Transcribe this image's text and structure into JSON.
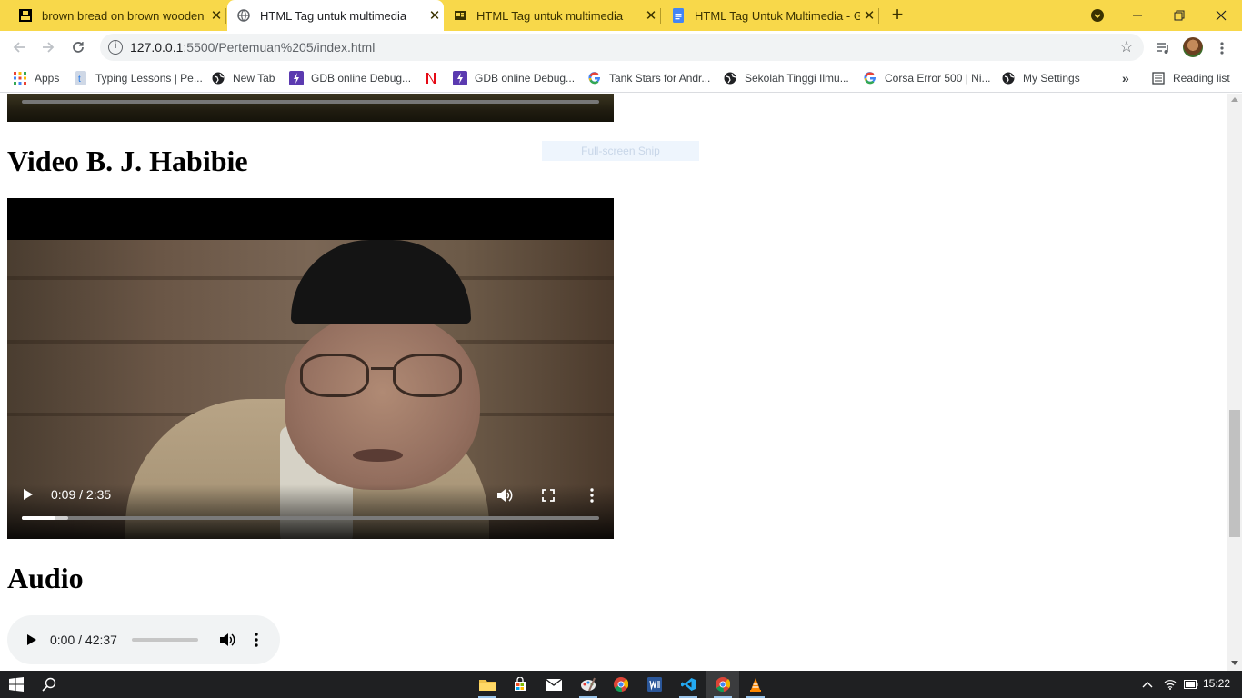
{
  "browser": {
    "tabs": [
      {
        "title": "brown bread on brown wooden t",
        "favicon": "unsplash-icon"
      },
      {
        "title": "HTML Tag untuk multimedia",
        "favicon": "globe-icon",
        "active": true
      },
      {
        "title": "HTML Tag untuk multimedia",
        "favicon": "document-icon"
      },
      {
        "title": "HTML Tag Untuk Multimedia - G",
        "favicon": "docs-icon"
      }
    ],
    "url_host": "127.0.0.1",
    "url_path": ":5500/Pertemuan%205/index.html",
    "bookmarks": [
      {
        "label": "Apps",
        "icon": "apps-grid-icon"
      },
      {
        "label": "Typing Lessons | Pe...",
        "icon": "typing-icon"
      },
      {
        "label": "New Tab",
        "icon": "globe-icon"
      },
      {
        "label": "GDB online Debug...",
        "icon": "gdb-icon"
      },
      {
        "label": "",
        "icon": "netflix-icon"
      },
      {
        "label": "GDB online Debug...",
        "icon": "gdb-icon"
      },
      {
        "label": "Tank Stars for Andr...",
        "icon": "google-icon"
      },
      {
        "label": "Sekolah Tinggi Ilmu...",
        "icon": "globe-icon"
      },
      {
        "label": "Corsa Error 500 | Ni...",
        "icon": "google-icon"
      },
      {
        "label": "My Settings",
        "icon": "globe-icon"
      }
    ],
    "reading_list": "Reading list",
    "colors": {
      "tabstrip": "#f8d84a"
    }
  },
  "page": {
    "video_heading": "Video B. J. Habibie",
    "snip_overlay": "Full-screen Snip",
    "video": {
      "time": "0:09 / 2:35",
      "progress": 0.058,
      "buffered": 0.08
    },
    "audio_heading": "Audio",
    "audio": {
      "time": "0:00 / 42:37",
      "progress": 0.0
    }
  },
  "taskbar": {
    "apps": [
      "file-explorer-icon",
      "store-icon",
      "mail-icon",
      "paint-icon",
      "chrome-icon",
      "word-icon",
      "vscode-icon",
      "chrome-active-icon",
      "vlc-icon"
    ],
    "clock": "15:22"
  }
}
